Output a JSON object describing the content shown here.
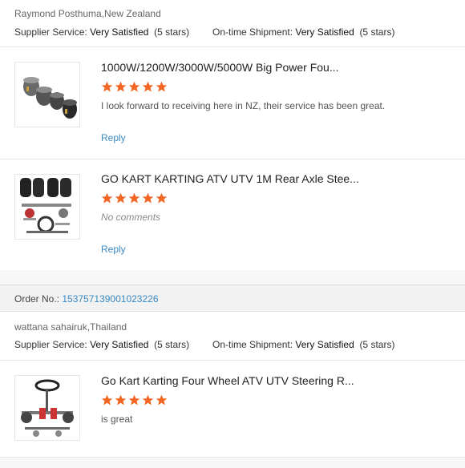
{
  "reviews": [
    {
      "buyer": "Raymond Posthuma,New Zealand",
      "supplier_label": "Supplier Service:",
      "supplier_value": "Very Satisfied",
      "supplier_stars": "(5 stars)",
      "shipment_label": "On-time Shipment:",
      "shipment_value": "Very Satisfied",
      "shipment_stars": "(5 stars)",
      "items": [
        {
          "title": "1000W/1200W/3000W/5000W Big Power Fou...",
          "stars": 5,
          "comment": "I look forward to receiving here in NZ, their service has been great.",
          "reply": "Reply",
          "image": "motor-kit-photo"
        },
        {
          "title": "GO KART KARTING ATV UTV 1M Rear Axle Stee...",
          "stars": 5,
          "comment": "No comments",
          "reply": "Reply",
          "image": "axle-kit-photo"
        }
      ]
    },
    {
      "order_label": "Order No.:",
      "order_number": "153757139001023226",
      "buyer": "wattana sahairuk,Thailand",
      "supplier_label": "Supplier Service:",
      "supplier_value": "Very Satisfied",
      "supplier_stars": "(5 stars)",
      "shipment_label": "On-time Shipment:",
      "shipment_value": "Very Satisfied",
      "shipment_stars": "(5 stars)",
      "items": [
        {
          "title": "Go Kart Karting Four Wheel ATV UTV Steering R...",
          "stars": 5,
          "comment": "is great",
          "image": "steering-kit-photo"
        }
      ]
    }
  ],
  "colors": {
    "star": "#f26522",
    "link": "#3a8ac4"
  }
}
